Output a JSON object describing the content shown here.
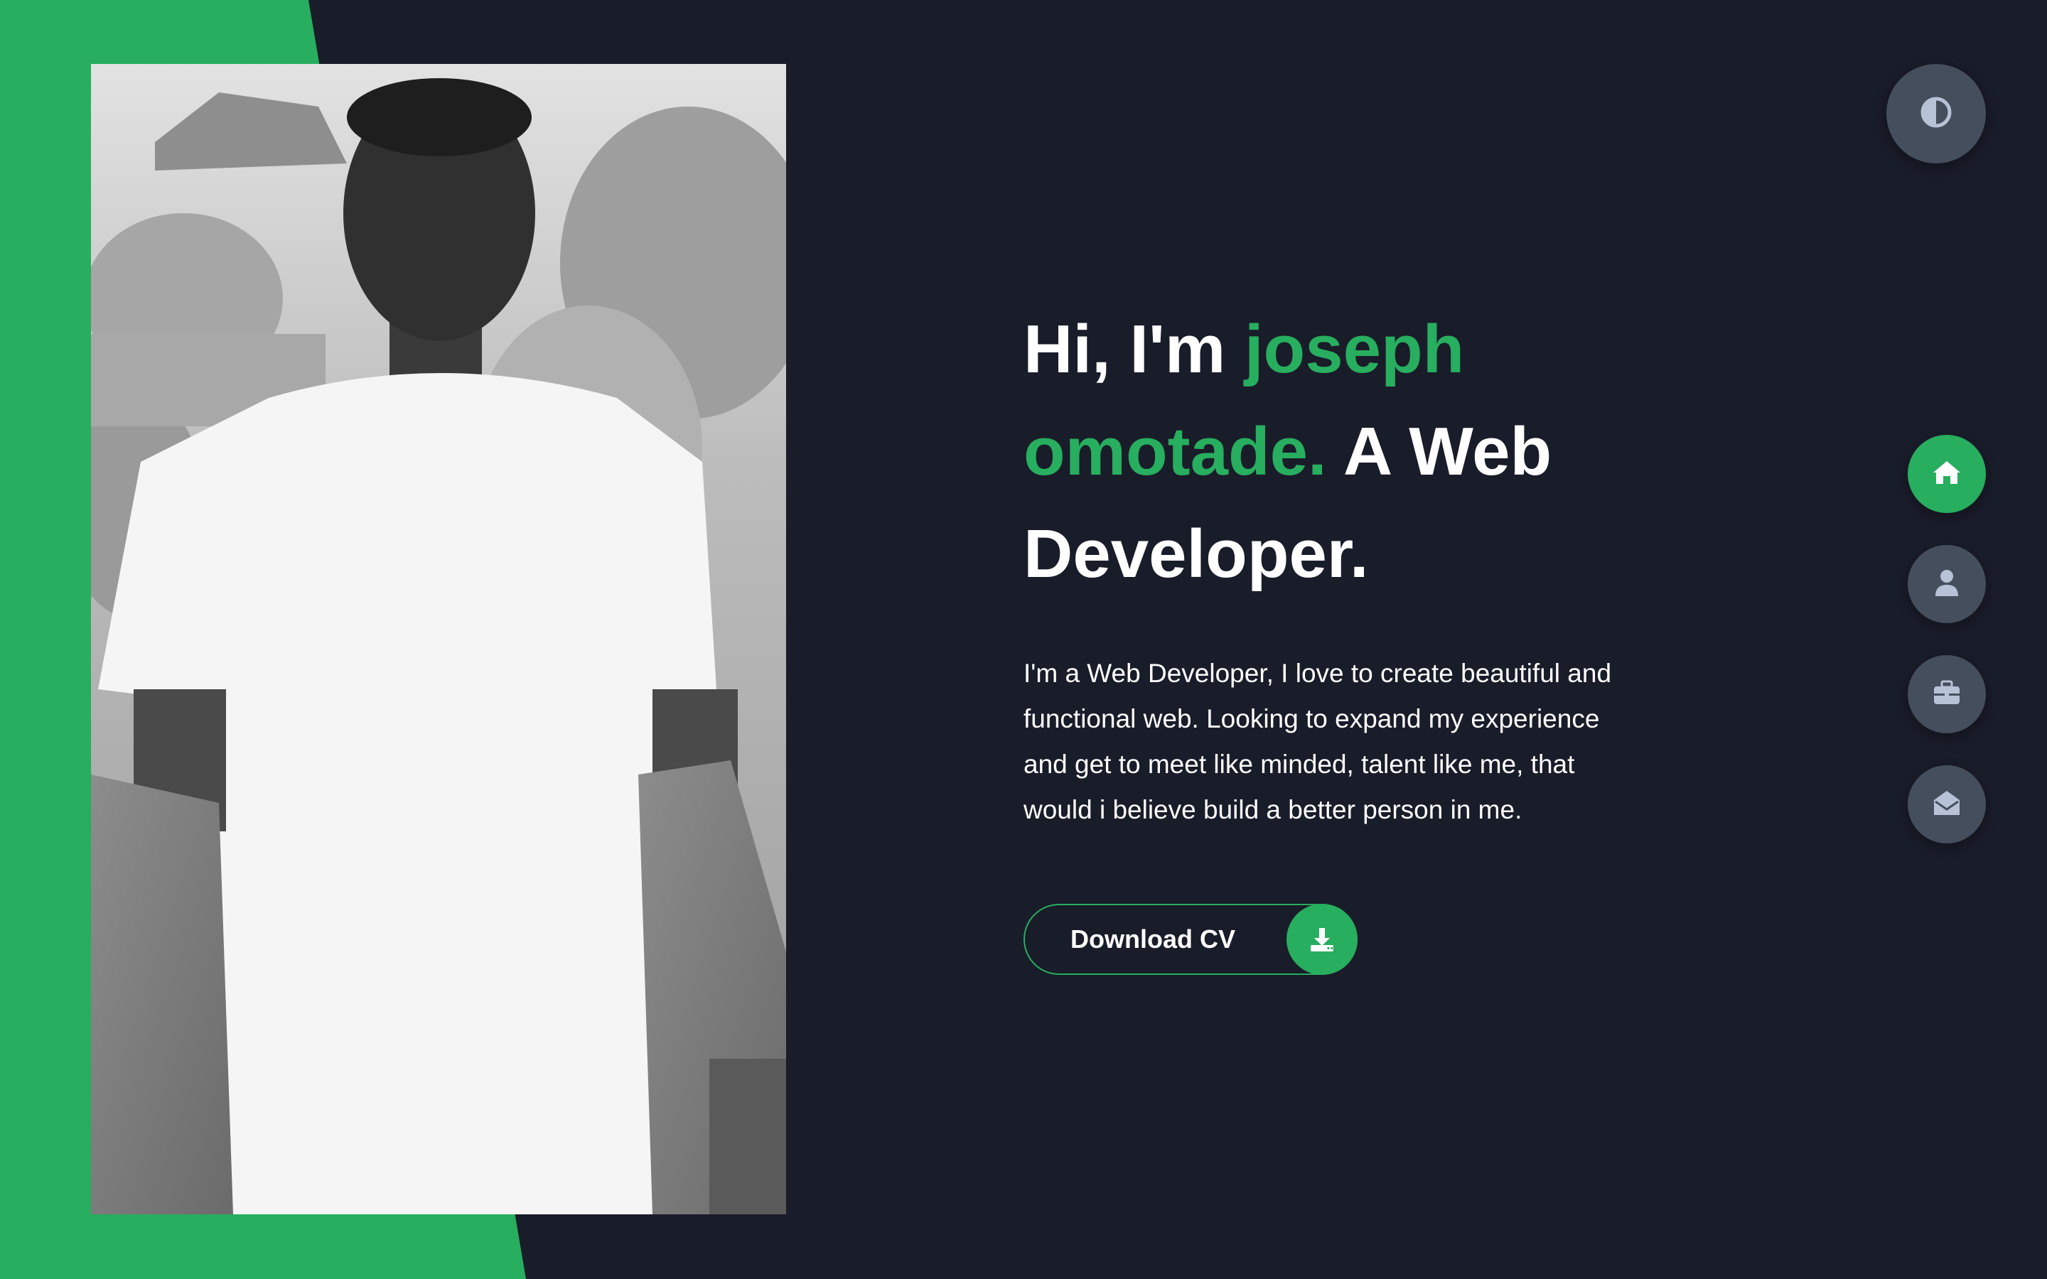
{
  "hero": {
    "headline_greeting": "Hi, I'm ",
    "headline_name": "joseph omotade.",
    "headline_role": " A Web Developer.",
    "intro": "I'm a Web Developer, I love to create beautiful and functional web. Looking to expand my experience and get to meet like minded, talent like me, that would i believe build a better person in me.",
    "download_label": "Download CV",
    "download_icon": "download-icon"
  },
  "photo": {
    "alt": "black and white portrait"
  },
  "theme_toggle": {
    "icon": "contrast-icon"
  },
  "nav": {
    "items": [
      {
        "icon": "home-icon",
        "active": true
      },
      {
        "icon": "user-icon",
        "active": false
      },
      {
        "icon": "briefcase-icon",
        "active": false
      },
      {
        "icon": "envelope-open-icon",
        "active": false
      }
    ]
  },
  "colors": {
    "background": "#191c29",
    "accent": "#27ae5f",
    "button_bg": "#454e5d",
    "icon_muted": "#b8c2d6",
    "text": "#ffffff"
  }
}
